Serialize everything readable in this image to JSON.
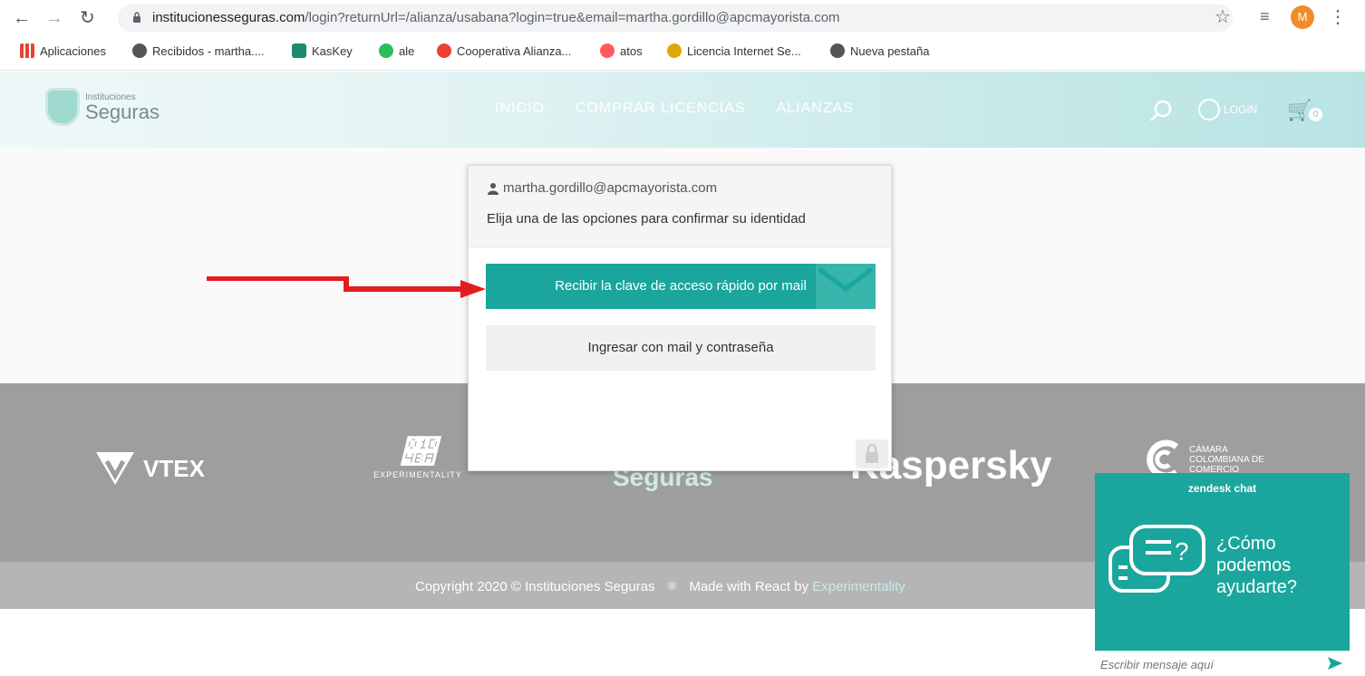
{
  "browser": {
    "url_host": "institucionesseguras.com",
    "url_path": "/login?returnUrl=/alianza/usabana?login=true&email=martha.gordillo@apcmayorista.com",
    "avatar_letter": "M",
    "bookmarks": [
      {
        "label": "Aplicaciones",
        "icon": "apps-grid-icon",
        "color": "#e94235"
      },
      {
        "label": "Recibidos - martha....",
        "icon": "globe-icon",
        "color": "#444"
      },
      {
        "label": "KasKey",
        "icon": "kaskey-icon",
        "color": "#1f8a70"
      },
      {
        "label": "ale",
        "icon": "badge-2-icon",
        "color": "#2dbd5b"
      },
      {
        "label": "Cooperativa Alianza...",
        "icon": "cooperativa-icon",
        "color": "#e94235"
      },
      {
        "label": "atos",
        "icon": "airbnb-icon",
        "color": "#ff5a5f"
      },
      {
        "label": "Licencia Internet Se...",
        "icon": "licencia-icon",
        "color": "#e0a800"
      },
      {
        "label": "Nueva pestaña",
        "icon": "globe-icon",
        "color": "#444"
      }
    ]
  },
  "site": {
    "logo_small": "Instituciones",
    "logo_big": "Seguras",
    "nav": [
      "INICIO",
      "COMPRAR LICENCIAS",
      "ALIANZAS"
    ],
    "login_label": "LOGIN",
    "cart_count": "0"
  },
  "modal": {
    "email": "martha.gordillo@apcmayorista.com",
    "instruction": "Elija una de las opciones para confirmar su identidad",
    "primary_button": "Recibir la clave de acceso rápido por mail",
    "secondary_button": "Ingresar con mail y contraseña"
  },
  "footer": {
    "logos": [
      "VTEX",
      "EXPERIMENTALITY",
      "Seguras",
      "Kaspersky",
      "CÁMARA COLOMBIANA DE COMERCIO"
    ],
    "copyright": "Copyright 2020 © Instituciones Seguras",
    "made_with": "Made with React by",
    "made_with_link": "Experimentality"
  },
  "chat": {
    "brand": "zendesk chat",
    "question": "¿Cómo podemos ayudarte?",
    "placeholder": "Escribir mensaje aquí"
  },
  "colors": {
    "accent": "#1aa69c",
    "arrow": "#e31e1e",
    "footer": "#9e9e9e"
  }
}
